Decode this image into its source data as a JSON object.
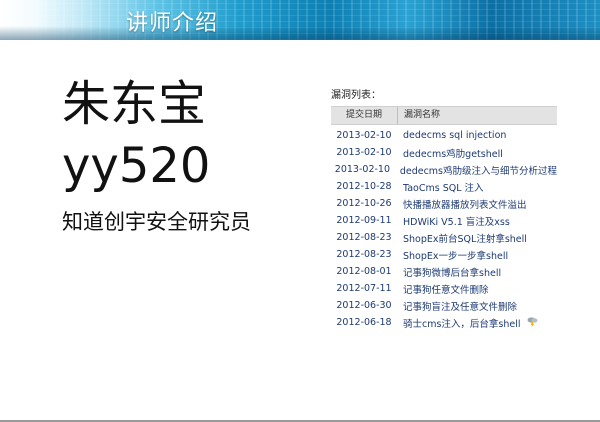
{
  "header": {
    "title": "讲师介绍"
  },
  "speaker": {
    "name": "朱东宝",
    "handle": "yy520",
    "title": "知道创宇安全研究员"
  },
  "vuln_list": {
    "caption": "漏洞列表：",
    "columns": {
      "date": "提交日期",
      "name": "漏洞名称"
    },
    "rows": [
      {
        "date": "2013-02-10",
        "name": "dedecms sql injection"
      },
      {
        "date": "2013-02-10",
        "name": "dedecms鸡肋getshell"
      },
      {
        "date": "2013-02-10",
        "name": "dedecms鸡肋级注入与细节分析过程"
      },
      {
        "date": "2012-10-28",
        "name": "TaoCms SQL 注入"
      },
      {
        "date": "2012-10-26",
        "name": "快播播放器播放列表文件溢出"
      },
      {
        "date": "2012-09-11",
        "name": "HDWiKi V5.1 盲注及xss"
      },
      {
        "date": "2012-08-23",
        "name": "ShopEx前台SQL注射拿shell"
      },
      {
        "date": "2012-08-23",
        "name": "ShopEx一步一步拿shell"
      },
      {
        "date": "2012-08-01",
        "name": "记事狗微博后台拿shell"
      },
      {
        "date": "2012-07-11",
        "name": "记事狗任意文件删除"
      },
      {
        "date": "2012-06-30",
        "name": "记事狗盲注及任意文件删除"
      },
      {
        "date": "2012-06-18",
        "name": "骑士cms注入，后台拿shell"
      }
    ],
    "last_row_icon": "weather-icon"
  },
  "colors": {
    "link": "#1d3a73",
    "header_bg": "#e3e3e3",
    "banner_blue": "#0d7fb3"
  }
}
